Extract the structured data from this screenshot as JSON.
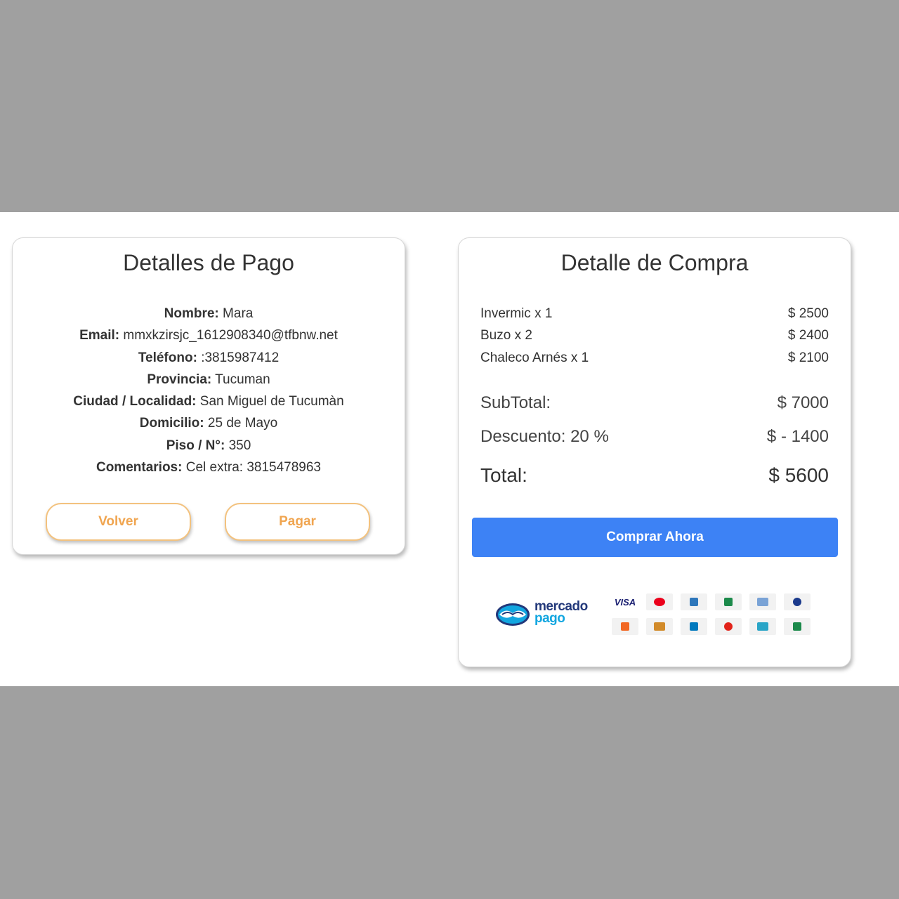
{
  "left_card": {
    "title": "Detalles de Pago",
    "details": [
      {
        "label": "Nombre:",
        "value": " Mara"
      },
      {
        "label": "Email:",
        "value": " mmxkzirsjc_1612908340@tfbnw.net"
      },
      {
        "label": "Teléfono:",
        "value": " :3815987412"
      },
      {
        "label": "Provincia:",
        "value": " Tucuman"
      },
      {
        "label": "Ciudad / Localidad:",
        "value": " San Miguel de Tucumàn"
      },
      {
        "label": "Domicilio:",
        "value": " 25 de Mayo"
      },
      {
        "label": "Piso / N°:",
        "value": " 350"
      },
      {
        "label": "Comentarios:",
        "value": " Cel extra: 3815478963"
      }
    ],
    "back_label": "Volver",
    "pay_label": "Pagar"
  },
  "right_card": {
    "title": "Detalle de Compra",
    "items": [
      {
        "name": "Invermic x 1",
        "price": "$ 2500"
      },
      {
        "name": "Buzo x 2",
        "price": "$ 2400"
      },
      {
        "name": "Chaleco Arnés x 1",
        "price": "$ 2100"
      }
    ],
    "subtotal_label": "SubTotal:",
    "subtotal_value": "$ 7000",
    "discount_label": "Descuento: 20 %",
    "discount_value": "$ - 1400",
    "total_label": "Total:",
    "total_value": "$ 5600",
    "buy_label": "Comprar Ahora",
    "brand_line1": "mercado",
    "brand_line2": "pago",
    "payment_methods": [
      {
        "name": "visa",
        "text": "VISA",
        "color": "#1a1f71"
      },
      {
        "name": "mastercard",
        "text": "",
        "color": "#eb001b"
      },
      {
        "name": "amex",
        "text": "",
        "color": "#2e77bb"
      },
      {
        "name": "naranja",
        "text": "",
        "color": "#1c8a4b"
      },
      {
        "name": "card5",
        "text": "",
        "color": "#7aa3d6"
      },
      {
        "name": "card6",
        "text": "",
        "color": "#1b3a8c"
      },
      {
        "name": "card7",
        "text": "",
        "color": "#f26722"
      },
      {
        "name": "cabal",
        "text": "",
        "color": "#d28b2a"
      },
      {
        "name": "diners",
        "text": "",
        "color": "#0079be"
      },
      {
        "name": "card10",
        "text": "",
        "color": "#e2231a"
      },
      {
        "name": "cencosud",
        "text": "",
        "color": "#2aa5c7"
      },
      {
        "name": "cordobesa",
        "text": "",
        "color": "#1c8a4b"
      }
    ]
  }
}
